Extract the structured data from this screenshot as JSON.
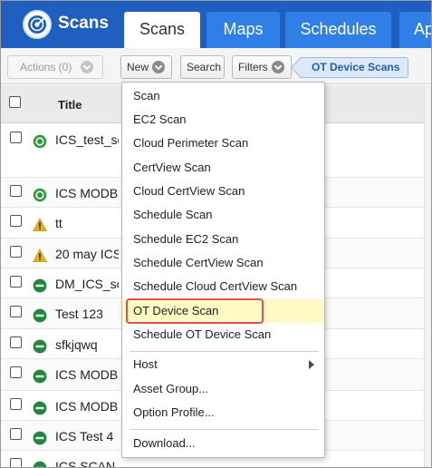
{
  "header": {
    "app_title": "Scans",
    "tabs": [
      {
        "label": "Scans",
        "active": true
      },
      {
        "label": "Maps",
        "active": false
      },
      {
        "label": "Schedules",
        "active": false
      },
      {
        "label": "Ap",
        "active": false
      }
    ],
    "colors": {
      "bar": "#1f5fbf",
      "tab": "#2f7fe6",
      "active_tab": "#ffffff"
    }
  },
  "toolbar": {
    "actions_label": "Actions (0)",
    "new_label": "New",
    "search_label": "Search",
    "filters_label": "Filters",
    "active_filter": "OT Device Scans"
  },
  "table": {
    "title_header": "Title",
    "rows": [
      {
        "title": "ICS_test_sc",
        "status": "running-green"
      },
      {
        "title": "ICS MODB",
        "status": "running-green"
      },
      {
        "title": "tt",
        "status": "warning"
      },
      {
        "title": "20 may ICS",
        "status": "warning"
      },
      {
        "title": "DM_ICS_sc",
        "status": "finished"
      },
      {
        "title": "Test 123",
        "status": "finished"
      },
      {
        "title": "sfkjqwq",
        "status": "finished"
      },
      {
        "title": "ICS MODB",
        "status": "finished"
      },
      {
        "title": "ICS MODB",
        "status": "finished"
      },
      {
        "title": "ICS Test 4",
        "status": "finished"
      },
      {
        "title": "ICS SCAN",
        "status": "finished"
      }
    ]
  },
  "new_menu": {
    "items": [
      "Scan",
      "EC2 Scan",
      "Cloud Perimeter Scan",
      "CertView Scan",
      "Cloud CertView Scan",
      "Schedule Scan",
      "Schedule EC2 Scan",
      "Schedule CertView Scan",
      "Schedule Cloud CertView Scan",
      "OT Device Scan",
      "Schedule OT Device Scan"
    ],
    "highlighted_item": "OT Device Scan",
    "section2": [
      "Host",
      "Asset Group...",
      "Option Profile..."
    ],
    "section3": [
      "Download..."
    ]
  }
}
